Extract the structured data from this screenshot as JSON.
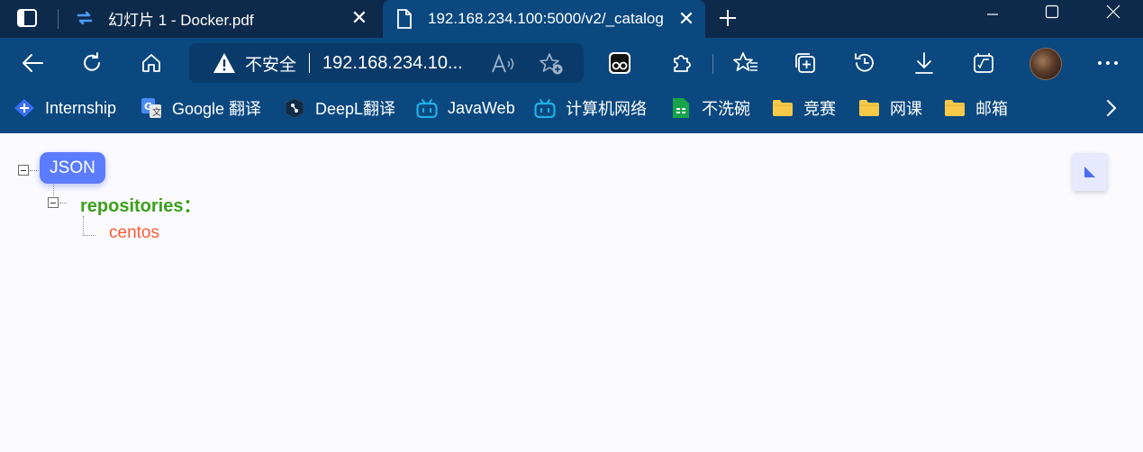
{
  "tabs": [
    {
      "label": "幻灯片 1 - Docker.pdf",
      "icon": "slides-sync-icon",
      "active": false
    },
    {
      "label": "192.168.234.100:5000/v2/_catalog",
      "icon": "page-icon",
      "active": true
    }
  ],
  "address_bar": {
    "security_label": "不安全",
    "url": "192.168.234.10..."
  },
  "bookmarks": [
    {
      "label": "Internship",
      "icon": "internship-icon"
    },
    {
      "label": "Google 翻译",
      "icon": "google-translate-icon"
    },
    {
      "label": "DeepL翻译",
      "icon": "deepl-icon"
    },
    {
      "label": "JavaWeb",
      "icon": "bilibili-icon"
    },
    {
      "label": "计算机网络",
      "icon": "bilibili-icon"
    },
    {
      "label": "不洗碗",
      "icon": "sheets-icon"
    },
    {
      "label": "竞赛",
      "icon": "folder-icon"
    },
    {
      "label": "网课",
      "icon": "folder-icon"
    },
    {
      "label": "邮箱",
      "icon": "folder-icon"
    }
  ],
  "json_viewer": {
    "root_label": "JSON",
    "key": "repositories：",
    "values": [
      "centos"
    ]
  },
  "colors": {
    "tab_strip": "#0e2a4a",
    "toolbar": "#0b4880",
    "json_badge": "#5b7cff",
    "key": "#3aa01a",
    "value": "#ff5a36"
  }
}
